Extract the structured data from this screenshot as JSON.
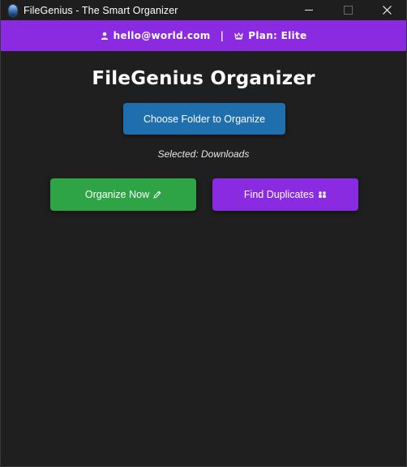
{
  "window": {
    "title": "FileGenius - The Smart Organizer"
  },
  "header": {
    "email": "hello@world.com",
    "separator": "|",
    "plan": "Plan: Elite",
    "background": "#8a2be2"
  },
  "main": {
    "title": "FileGenius Organizer",
    "choose_button_label": "Choose Folder to Organize",
    "selected_text": "Selected: Downloads",
    "organize_button_label": "Organize Now",
    "duplicates_button_label": "Find Duplicates"
  },
  "colors": {
    "choose_button": "#1f6fae",
    "organize_button": "#2ea447",
    "duplicates_button": "#8a2be2",
    "background": "#1f1f1f"
  },
  "icons": {
    "app": "app-icon",
    "user": "user-icon",
    "plan": "crown-icon",
    "organize": "pencil-icon",
    "duplicates": "duplicates-icon"
  }
}
